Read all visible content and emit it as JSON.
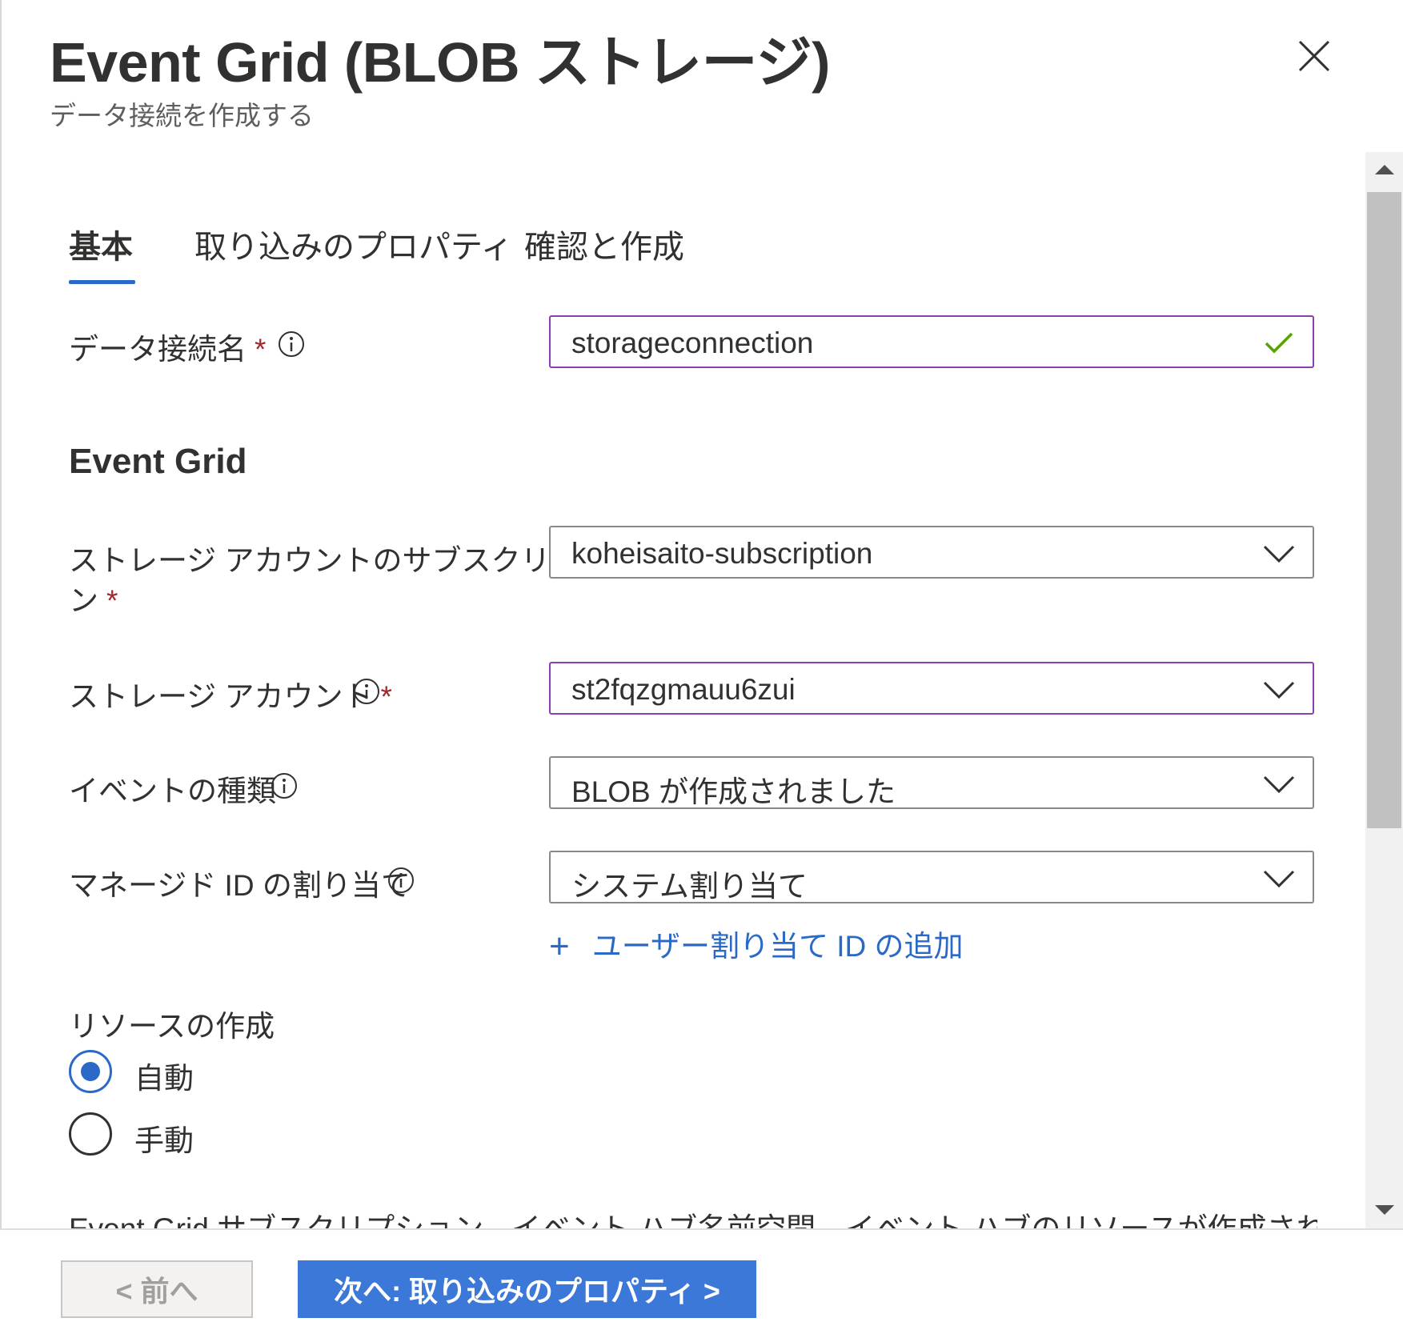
{
  "header": {
    "title": "Event Grid (BLOB ストレージ)",
    "subtitle": "データ接続を作成する"
  },
  "tabs": [
    {
      "label": "基本",
      "active": true
    },
    {
      "label": "取り込みのプロパティ",
      "active": false
    },
    {
      "label": "確認と作成",
      "active": false
    }
  ],
  "form": {
    "connection_name": {
      "label": "データ接続名",
      "required_mark": "*",
      "value": "storageconnection",
      "valid": true
    },
    "section_heading": "Event Grid",
    "subscription": {
      "label_line1": "ストレージ アカウントのサブスクリプショ",
      "label_line2": "ン",
      "required_mark": "*",
      "value": "koheisaito-subscription"
    },
    "storage_account": {
      "label": "ストレージ アカウント",
      "required_mark": "*",
      "value": "st2fqzgmauu6zui"
    },
    "event_type": {
      "label": "イベントの種類",
      "value": "BLOB が作成されました"
    },
    "managed_identity": {
      "label": "マネージド ID の割り当て",
      "value": "システム割り当て"
    },
    "add_user_identity_link": "ユーザー割り当て ID の追加",
    "resource_creation": {
      "label": "リソースの作成",
      "options": [
        {
          "label": "自動",
          "selected": true
        },
        {
          "label": "手動",
          "selected": false
        }
      ]
    },
    "truncated_note": "Event Grid サブスクリプション、イベント ハブ名前空間、イベント ハブのリソースが作成されます。後でポ"
  },
  "footer": {
    "prev_label": "< 前へ",
    "next_label": "次へ: 取り込みのプロパティ >"
  },
  "colors": {
    "accent": "#2b69c8",
    "primary_button": "#3b78d8",
    "focus_border": "#8a3fb3",
    "valid_check": "#57a300",
    "required": "#a4262c"
  }
}
